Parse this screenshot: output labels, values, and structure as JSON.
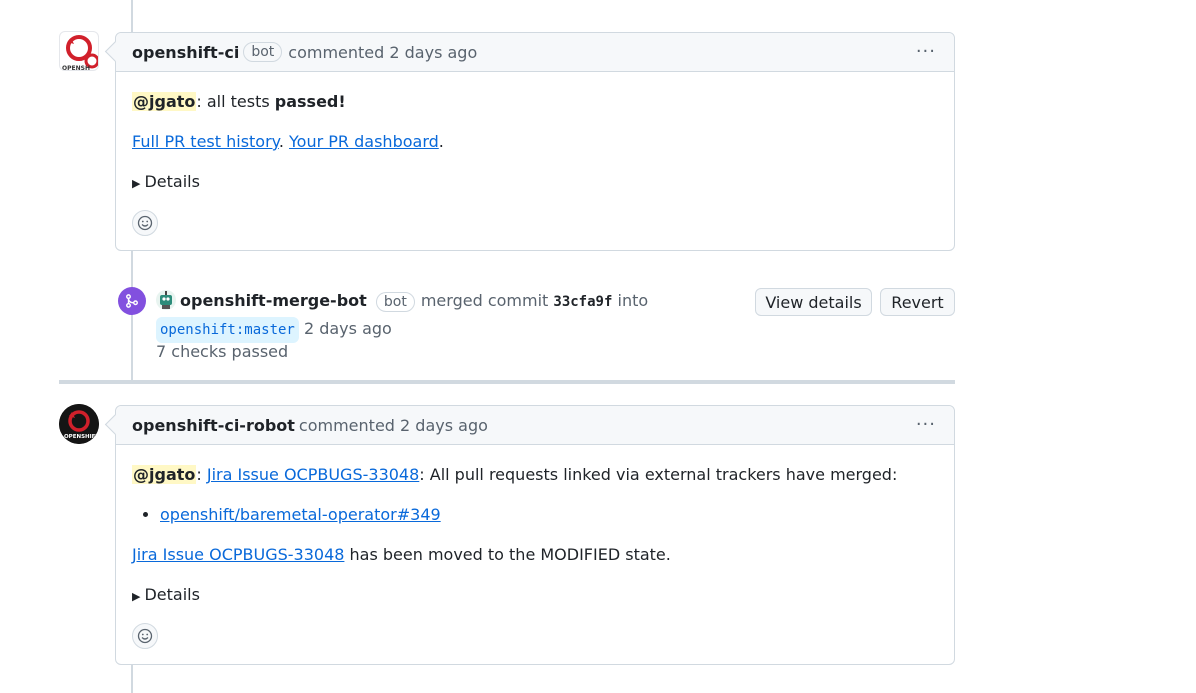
{
  "comment1": {
    "author": "openshift-ci",
    "badge": "bot",
    "action": "commented 2 days ago",
    "mention": "@jgato",
    "text_after_mention": ": all tests ",
    "passed": "passed!",
    "link1": "Full PR test history",
    "sep": ". ",
    "link2": "Your PR dashboard",
    "end": ".",
    "details": "Details"
  },
  "merge_event": {
    "author": "openshift-merge-bot",
    "badge": "bot",
    "action": "merged commit",
    "sha": "33cfa9f",
    "into": "into",
    "branch": "openshift:master",
    "time": "2 days ago",
    "checks": "7 checks passed",
    "view_details": "View details",
    "revert": "Revert"
  },
  "comment2": {
    "author": "openshift-ci-robot",
    "action": "commented 2 days ago",
    "mention": "@jgato",
    "colon": ": ",
    "jira_link": "Jira Issue OCPBUGS-33048",
    "text1": ": All pull requests linked via external trackers have merged:",
    "ref_link": "openshift/baremetal-operator#349",
    "jira_link2": "Jira Issue OCPBUGS-33048",
    "text2": " has been moved to the MODIFIED state.",
    "details": "Details"
  },
  "icons": {
    "kebab": "kebab-horizontal-icon",
    "smiley": "smiley-icon",
    "merge": "git-merge-icon",
    "triangle": "triangle-right-icon"
  },
  "colors": {
    "accent": "#0969da",
    "merged": "#8250df",
    "border": "#d1d9e0",
    "header_bg": "#f6f8fa"
  }
}
